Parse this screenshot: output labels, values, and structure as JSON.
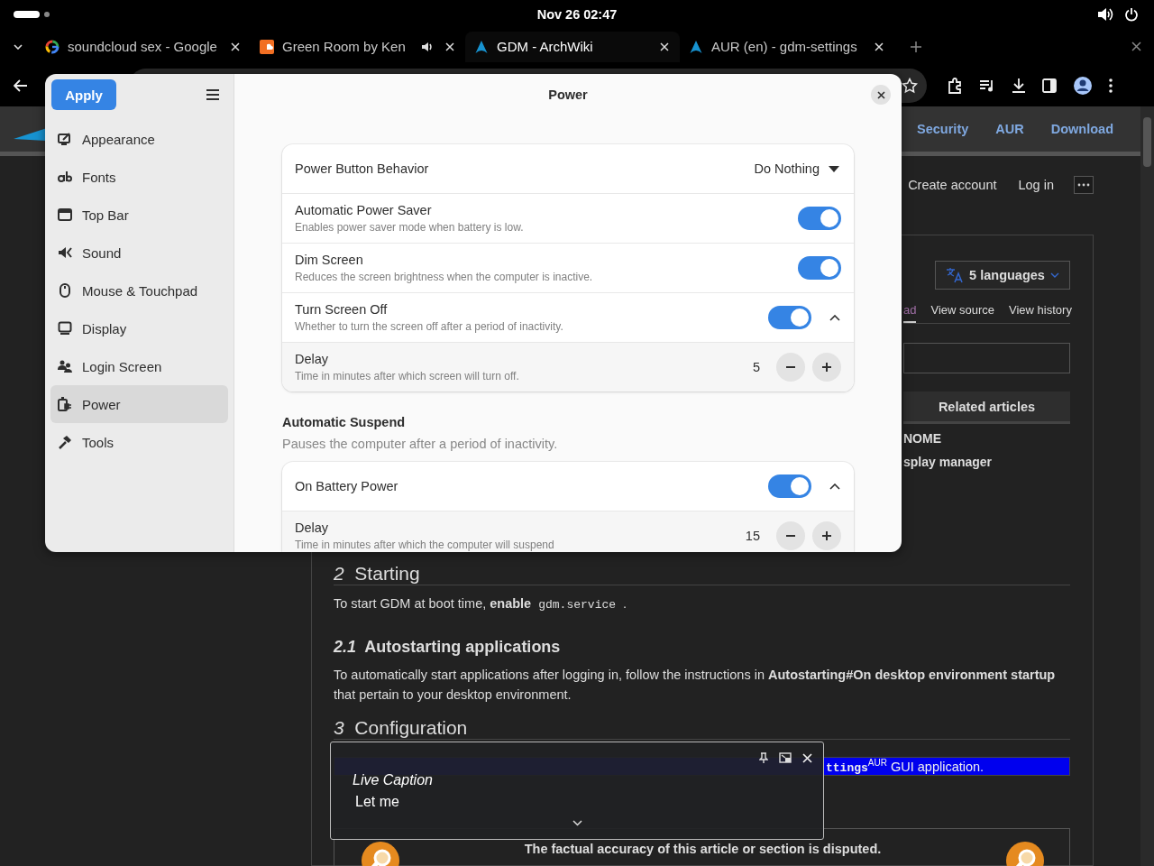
{
  "top_bar": {
    "clock": "Nov 26  02:47"
  },
  "tabs": [
    {
      "title": "soundcloud sex - Google",
      "selected": false,
      "audio": false
    },
    {
      "title": "Green Room by Ken",
      "selected": false,
      "audio": true
    },
    {
      "title": "GDM - ArchWiki",
      "selected": true,
      "audio": false
    },
    {
      "title": "AUR (en) - gdm-settings",
      "selected": false,
      "audio": false
    }
  ],
  "wiki": {
    "nav_links": [
      "Security",
      "AUR",
      "Download"
    ],
    "user_links": [
      "Create account",
      "Log in"
    ],
    "languages": "5 languages",
    "page_tabs": [
      {
        "label": "ad",
        "selected": true
      },
      {
        "label": "View source",
        "selected": false
      },
      {
        "label": "View history",
        "selected": false
      }
    ],
    "related": {
      "title": "Related articles",
      "items": [
        "NOME",
        "splay manager"
      ]
    },
    "sections": [
      {
        "kind": "section",
        "number": "2",
        "title": "Starting",
        "paragraph": [
          {
            "kind": "text",
            "text": "To start GDM at boot time, **enable** "
          },
          {
            "kind": "code",
            "text": "gdm.service"
          },
          {
            "kind": "text",
            "text": " ."
          }
        ]
      },
      {
        "kind": "subsection",
        "number": "2.1",
        "title": "Autostarting applications",
        "paragraph": [
          {
            "kind": "text",
            "text": "To automatically start applications after logging in, follow the instructions in "
          },
          {
            "kind": "link",
            "text": "Autostarting#On desktop environment startup"
          },
          {
            "kind": "text",
            "text": " that pertain to your desktop environment."
          }
        ]
      },
      {
        "kind": "section",
        "number": "3",
        "title": "Configuration"
      }
    ],
    "note": [
      {
        "kind": "code",
        "text": "ttings"
      },
      {
        "kind": "sup",
        "text": "AUR"
      },
      {
        "kind": "text",
        "text": " GUI application."
      }
    ],
    "disputed": "The factual accuracy of this article or section is disputed."
  },
  "dialog": {
    "apply": "Apply",
    "title": "Power",
    "sidebar": [
      {
        "label": "Appearance",
        "selected": false
      },
      {
        "label": "Fonts",
        "selected": false
      },
      {
        "label": "Top Bar",
        "selected": false
      },
      {
        "label": "Sound",
        "selected": false
      },
      {
        "label": "Mouse & Touchpad",
        "selected": false
      },
      {
        "label": "Display",
        "selected": false
      },
      {
        "label": "Login Screen",
        "selected": false
      },
      {
        "label": "Power",
        "selected": true
      },
      {
        "label": "Tools",
        "selected": false
      }
    ],
    "rows": [
      {
        "kind": "dropdown",
        "title": "Power Button Behavior",
        "value": "Do Nothing"
      },
      {
        "kind": "switch",
        "title": "Automatic Power Saver",
        "subtitle": "Enables power saver mode when battery is low.",
        "on": true
      },
      {
        "kind": "switch",
        "title": "Dim Screen",
        "subtitle": "Reduces the screen brightness when the computer is inactive.",
        "on": true
      },
      {
        "kind": "switch",
        "title": "Turn Screen Off",
        "subtitle": "Whether to turn the screen off after a period of inactivity.",
        "on": true,
        "expanded": true
      },
      {
        "kind": "spin",
        "title": "Delay",
        "subtitle": "Time in minutes after which screen will turn off.",
        "value": "5"
      }
    ],
    "suspend": {
      "title": "Automatic Suspend",
      "description": "Pauses the computer after a period of inactivity.",
      "rows": [
        {
          "kind": "switch",
          "title": "On Battery Power",
          "on": true,
          "expanded": true
        },
        {
          "kind": "spin",
          "title": "Delay",
          "subtitle": "Time in minutes after which the computer will suspend",
          "value": "15"
        }
      ]
    }
  },
  "live_caption": {
    "title": "Live Caption",
    "text": "Let me"
  }
}
